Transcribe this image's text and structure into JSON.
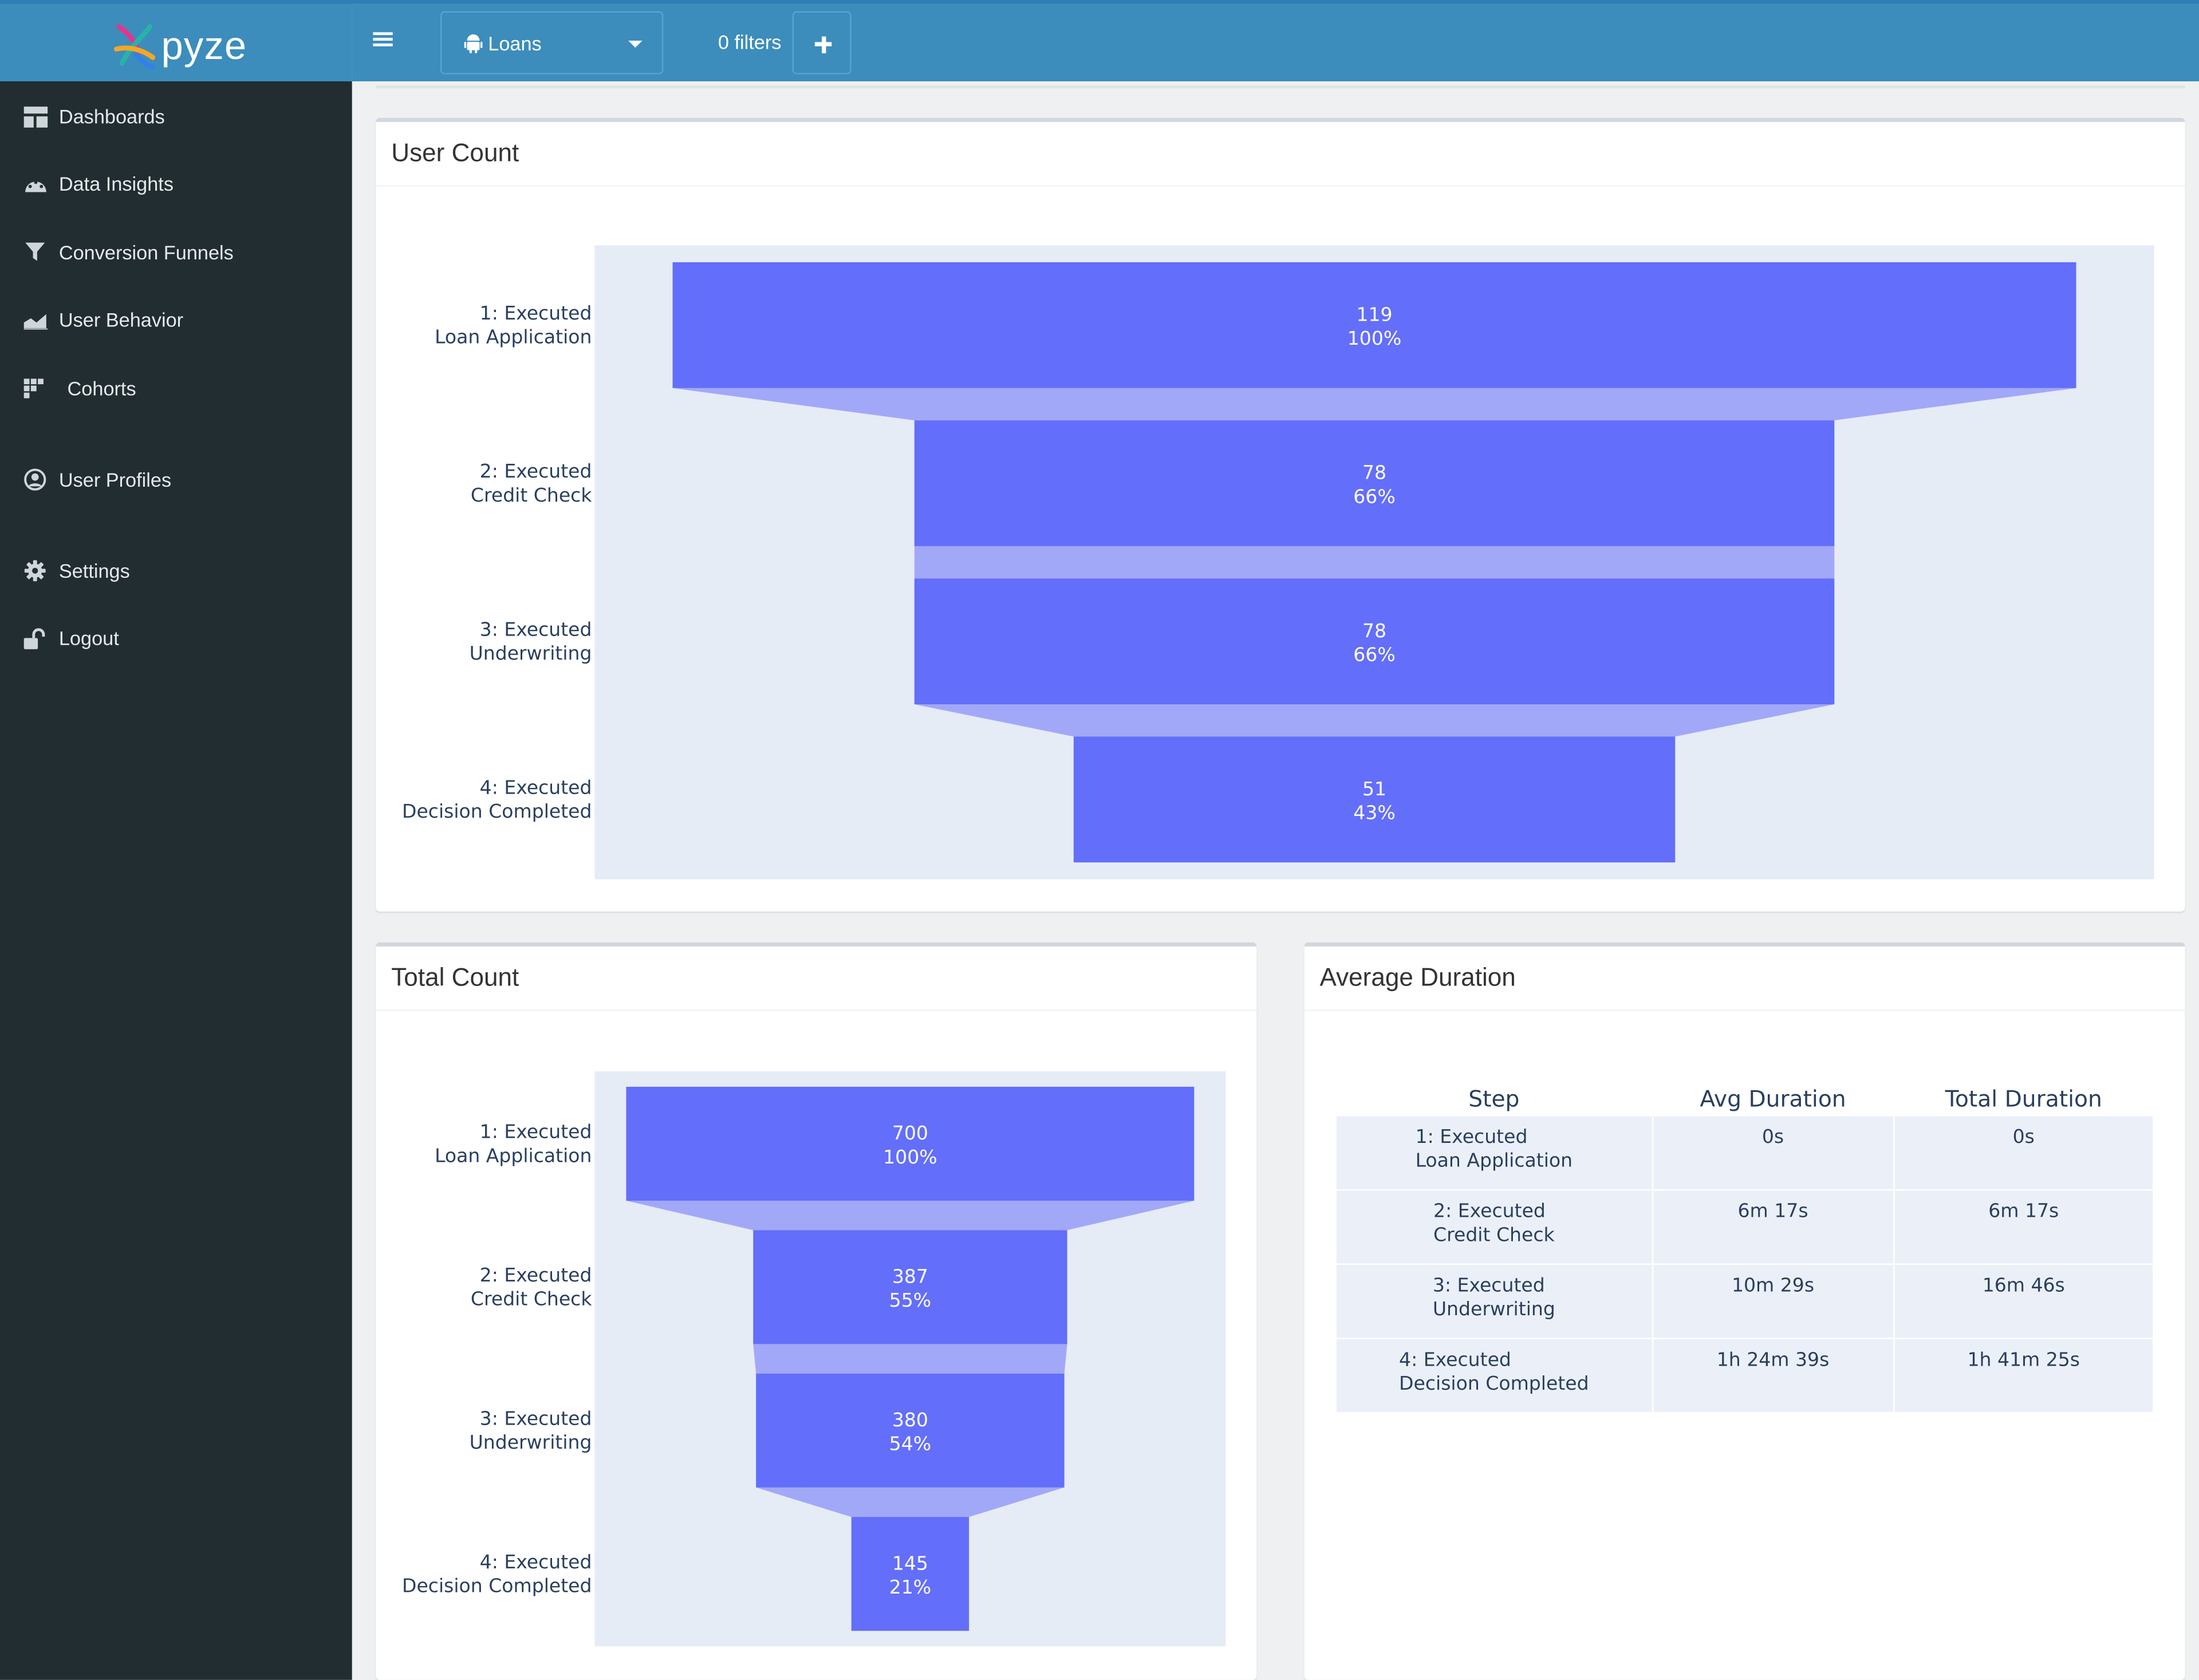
{
  "brand": {
    "name": "pyze",
    "mark_colors": [
      "#e8338a",
      "#27b3a8",
      "#f5a623",
      "#2f80ed"
    ]
  },
  "theme": {
    "header_bg": "#3c8dbc",
    "sidebar_bg": "#222d32",
    "funnel_bar": "#636efa",
    "funnel_connector": "#a2a8f8",
    "plot_bg": "#e5ecf6"
  },
  "sidebar": {
    "items": [
      {
        "label": "Dashboards",
        "icon": "dashboard-icon"
      },
      {
        "label": "Data Insights",
        "icon": "palette-icon"
      },
      {
        "label": "Conversion Funnels",
        "icon": "filter-icon"
      },
      {
        "label": "User Behavior",
        "icon": "area-chart-icon"
      },
      {
        "label": "Cohorts",
        "icon": "cohort-grid-icon"
      },
      {
        "label": "User Profiles",
        "icon": "user-circle-icon"
      },
      {
        "label": "Settings",
        "icon": "gear-icon"
      },
      {
        "label": "Logout",
        "icon": "unlock-icon"
      }
    ]
  },
  "header": {
    "app_select": {
      "value": "Loans",
      "icon": "android-icon"
    },
    "filters_label": "0 filters",
    "add_filter_icon": "plus-icon"
  },
  "panels": {
    "user_count": {
      "title": "User Count"
    },
    "total_count": {
      "title": "Total Count"
    },
    "avg_duration": {
      "title": "Average Duration"
    }
  },
  "chart_data": [
    {
      "type": "funnel",
      "title": "User Count",
      "categories": [
        "1: Executed\nLoan Application",
        "2: Executed\nCredit Check",
        "3: Executed\nUnderwriting",
        "4: Executed\nDecision Completed"
      ],
      "values": [
        119,
        78,
        78,
        51
      ],
      "percent_labels": [
        "100%",
        "66%",
        "66%",
        "43%"
      ]
    },
    {
      "type": "funnel",
      "title": "Total Count",
      "categories": [
        "1: Executed\nLoan Application",
        "2: Executed\nCredit Check",
        "3: Executed\nUnderwriting",
        "4: Executed\nDecision Completed"
      ],
      "values": [
        700,
        387,
        380,
        145
      ],
      "percent_labels": [
        "100%",
        "55%",
        "54%",
        "21%"
      ]
    },
    {
      "type": "table",
      "title": "Average Duration",
      "columns": [
        "Step",
        "Avg Duration",
        "Total Duration"
      ],
      "rows": [
        [
          "1: Executed\nLoan Application",
          "0s",
          "0s"
        ],
        [
          "2: Executed\nCredit Check",
          "6m 17s",
          "6m 17s"
        ],
        [
          "3: Executed\nUnderwriting",
          "10m 29s",
          "16m 46s"
        ],
        [
          "4: Executed\nDecision Completed",
          "1h 24m 39s",
          "1h 41m 25s"
        ]
      ]
    }
  ]
}
